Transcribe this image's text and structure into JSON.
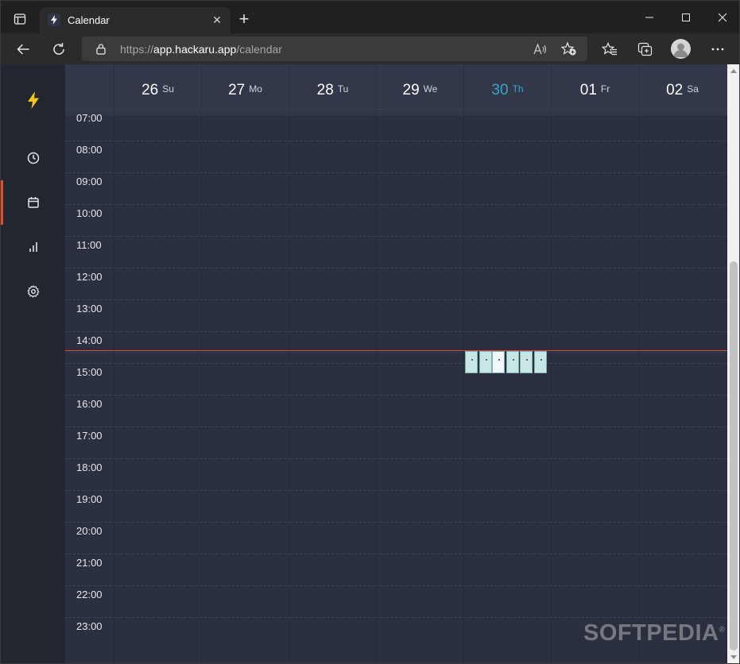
{
  "browser": {
    "tab_title": "Calendar",
    "url_prefix": "https://",
    "url_host": "app.hackaru.app",
    "url_path": "/calendar",
    "icons": [
      "tab-actions-icon",
      "favicon-bolt-icon",
      "close-icon",
      "new-tab-icon",
      "minimize-icon",
      "maximize-icon",
      "window-close-icon",
      "back-icon",
      "refresh-icon",
      "lock-icon",
      "read-aloud-icon",
      "add-favorite-icon",
      "favorites-icon",
      "collections-icon",
      "profile-icon",
      "more-icon"
    ]
  },
  "sidebar": {
    "items": [
      {
        "name": "logo-bolt-icon"
      },
      {
        "name": "timer-clock-icon"
      },
      {
        "name": "calendar-icon",
        "active": true
      },
      {
        "name": "reports-chart-icon"
      },
      {
        "name": "settings-gear-icon"
      }
    ],
    "accent": "#e0502f",
    "logo_color": "#f5c518"
  },
  "calendar": {
    "days": [
      {
        "num": "26",
        "abbr": "Su"
      },
      {
        "num": "27",
        "abbr": "Mo"
      },
      {
        "num": "28",
        "abbr": "Tu"
      },
      {
        "num": "29",
        "abbr": "We"
      },
      {
        "num": "30",
        "abbr": "Th",
        "today": true
      },
      {
        "num": "01",
        "abbr": "Fr"
      },
      {
        "num": "02",
        "abbr": "Sa"
      }
    ],
    "hours": [
      "07:00",
      "08:00",
      "09:00",
      "10:00",
      "11:00",
      "12:00",
      "13:00",
      "14:00",
      "15:00",
      "16:00",
      "17:00",
      "18:00",
      "19:00",
      "20:00",
      "21:00",
      "22:00",
      "23:00"
    ],
    "today_color": "#3aa4c8",
    "now_line_color": "#e04a34",
    "event_count": 6
  },
  "watermark": "SOFTPEDIA"
}
